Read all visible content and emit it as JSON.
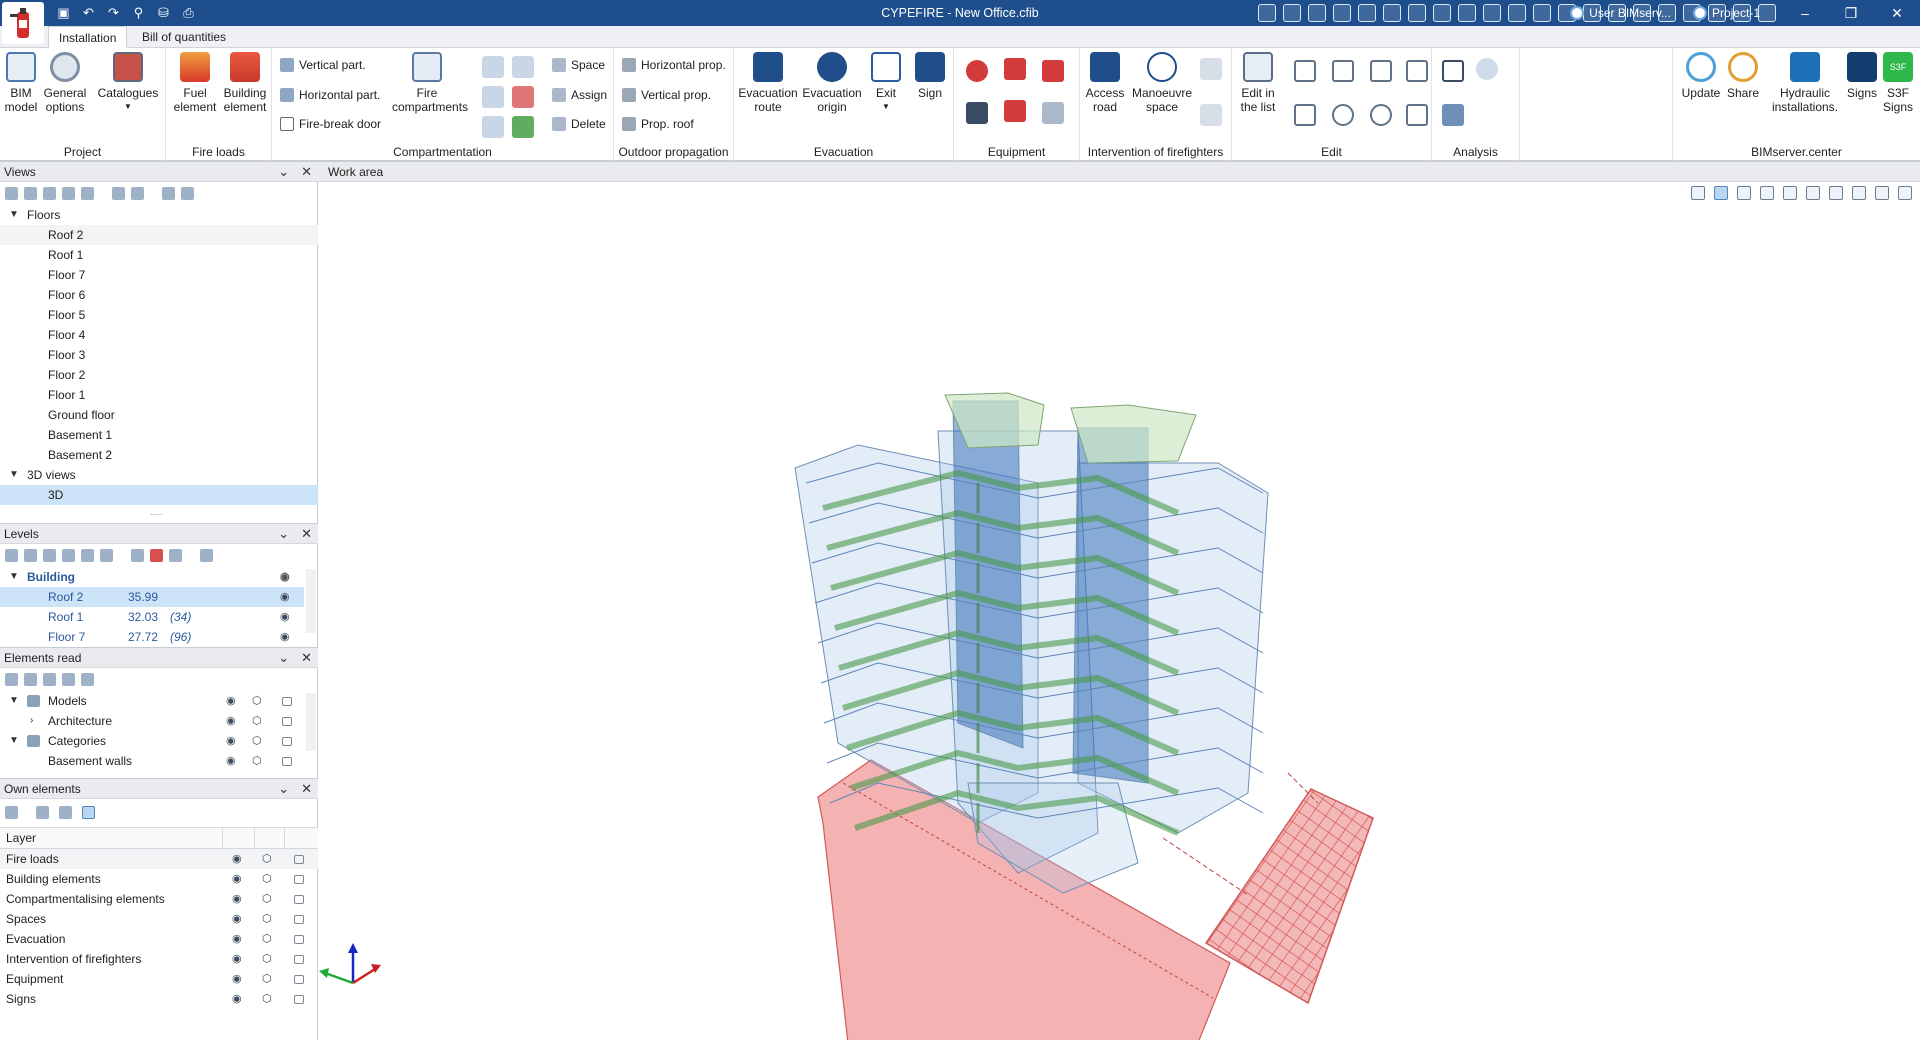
{
  "window": {
    "title": "CYPEFIRE - New Office.cfib",
    "user": "User BIMserv...",
    "project": "Project-1",
    "controls": {
      "minimize": "–",
      "restore": "❐",
      "close": "✕"
    }
  },
  "quick_access": [
    "save-icon",
    "undo-icon",
    "redo-icon",
    "zoom-icon",
    "export-icon",
    "print-icon"
  ],
  "tabs": [
    {
      "label": "Installation",
      "active": true
    },
    {
      "label": "Bill of quantities",
      "active": false
    }
  ],
  "ribbon": {
    "project": {
      "label": "Project",
      "bim_model": "BIM\nmodel",
      "general_options": "General\noptions",
      "catalogues": "Catalogues"
    },
    "fire_loads": {
      "label": "Fire loads",
      "fuel_element": "Fuel\nelement",
      "building_element": "Building\nelement"
    },
    "compartmentation": {
      "label": "Compartmentation",
      "vertical_part": "Vertical part.",
      "horizontal_part": "Horizontal part.",
      "fire_break_door": "Fire-break door",
      "fire_compartments": "Fire\ncompartments",
      "space": "Space",
      "assign": "Assign",
      "delete": "Delete"
    },
    "outdoor_propagation": {
      "label": "Outdoor propagation",
      "horizontal_prop": "Horizontal prop.",
      "vertical_prop": "Vertical prop.",
      "prop_roof": "Prop. roof"
    },
    "evacuation": {
      "label": "Evacuation",
      "evacuation_route": "Evacuation\nroute",
      "evacuation_origin": "Evacuation\norigin",
      "exit": "Exit",
      "sign": "Sign"
    },
    "equipment": {
      "label": "Equipment"
    },
    "intervention": {
      "label": "Intervention of firefighters",
      "access_road": "Access\nroad",
      "manoeuvre_space": "Manoeuvre\nspace"
    },
    "edit": {
      "label": "Edit",
      "edit_in_list": "Edit in\nthe list"
    },
    "analysis": {
      "label": "Analysis"
    },
    "bimserver": {
      "label": "BIMserver.center",
      "update": "Update",
      "share": "Share",
      "hydraulic": "Hydraulic\ninstallations.",
      "signs": "Signs",
      "s3f_signs": "S3F\nSigns",
      "s3f_tile": "S3F"
    }
  },
  "views_panel": {
    "title": "Views",
    "floors_label": "Floors",
    "floors": [
      "Roof 2",
      "Roof 1",
      "Floor 7",
      "Floor 6",
      "Floor 5",
      "Floor 4",
      "Floor 3",
      "Floor 2",
      "Floor 1",
      "Ground floor",
      "Basement 1",
      "Basement 2"
    ],
    "views3d_label": "3D views",
    "views3d": [
      "3D"
    ],
    "splitter": "....."
  },
  "levels_panel": {
    "title": "Levels",
    "group": "Building",
    "rows": [
      {
        "name": "Roof 2",
        "value": "35.99",
        "extra": ""
      },
      {
        "name": "Roof 1",
        "value": "32.03",
        "extra": "(34)"
      },
      {
        "name": "Floor 7",
        "value": "27.72",
        "extra": "(96)"
      }
    ]
  },
  "elements_read_panel": {
    "title": "Elements read",
    "rows": [
      "Models",
      "Architecture",
      "Categories",
      "Basement walls"
    ]
  },
  "own_elements_panel": {
    "title": "Own elements",
    "column_header": "Layer",
    "layers": [
      "Fire loads",
      "Building elements",
      "Compartmentalising elements",
      "Spaces",
      "Evacuation",
      "Intervention of firefighters",
      "Equipment",
      "Signs"
    ]
  },
  "work_area": {
    "title": "Work area"
  },
  "colors": {
    "titlebar": "#1e4f8c",
    "selection": "#cde3f7",
    "building_glass": "#9cc3ea",
    "core": "#2f6fbd",
    "routes": "#4a9a4a",
    "access_zone": "#e77b7b"
  }
}
